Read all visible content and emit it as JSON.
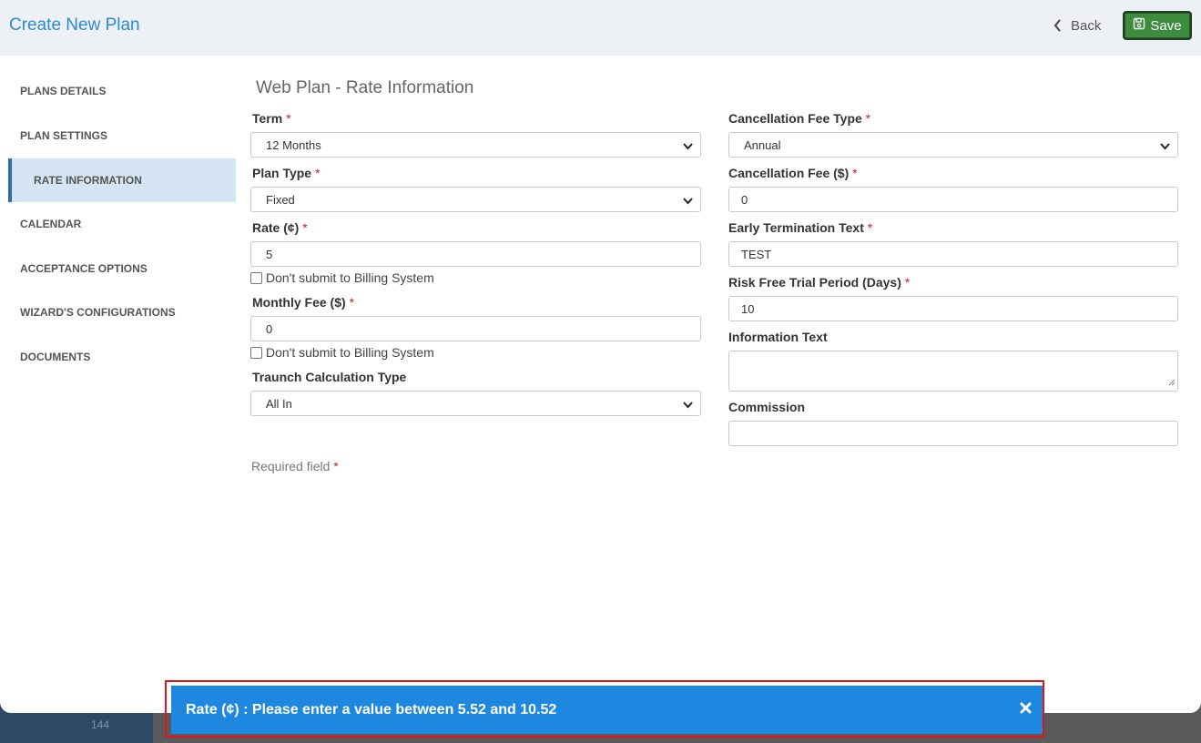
{
  "background": {
    "number": "144"
  },
  "header": {
    "title": "Create New Plan",
    "back_label": "Back",
    "save_label": "Save"
  },
  "sidebar": {
    "items": [
      {
        "label": "PLANS DETAILS"
      },
      {
        "label": "PLAN SETTINGS"
      },
      {
        "label": "RATE INFORMATION"
      },
      {
        "label": "CALENDAR"
      },
      {
        "label": "ACCEPTANCE OPTIONS"
      },
      {
        "label": "WIZARD'S CONFIGURATIONS"
      },
      {
        "label": "DOCUMENTS"
      }
    ],
    "active_index": 2
  },
  "form": {
    "section_title": "Web Plan - Rate Information",
    "term": {
      "label": "Term",
      "value": "12 Months"
    },
    "plan_type": {
      "label": "Plan Type",
      "value": "Fixed"
    },
    "rate": {
      "label": "Rate (¢)",
      "value": "5",
      "checkbox_label": "Don't submit to Billing System"
    },
    "monthly_fee": {
      "label": "Monthly Fee ($)",
      "value": "0",
      "checkbox_label": "Don't submit to Billing System"
    },
    "traunch": {
      "label": "Traunch Calculation Type",
      "value": "All In"
    },
    "cancellation_fee_type": {
      "label": "Cancellation Fee Type",
      "value": "Annual"
    },
    "cancellation_fee": {
      "label": "Cancellation Fee ($)",
      "value": "0"
    },
    "early_termination": {
      "label": "Early Termination Text",
      "value": "TEST"
    },
    "risk_free": {
      "label": "Risk Free Trial Period (Days)",
      "value": "10"
    },
    "information_text": {
      "label": "Information Text",
      "value": ""
    },
    "commission": {
      "label": "Commission",
      "value": ""
    },
    "required_note": "Required field",
    "required_marker": "*"
  },
  "toast": {
    "message": "Rate (¢) : Please enter a value between 5.52 and 10.52"
  },
  "colors": {
    "accent": "#2a8bd2",
    "save": "#3d8b3d",
    "toast": "#1e88e0",
    "active_nav": "#d6e5f3"
  }
}
